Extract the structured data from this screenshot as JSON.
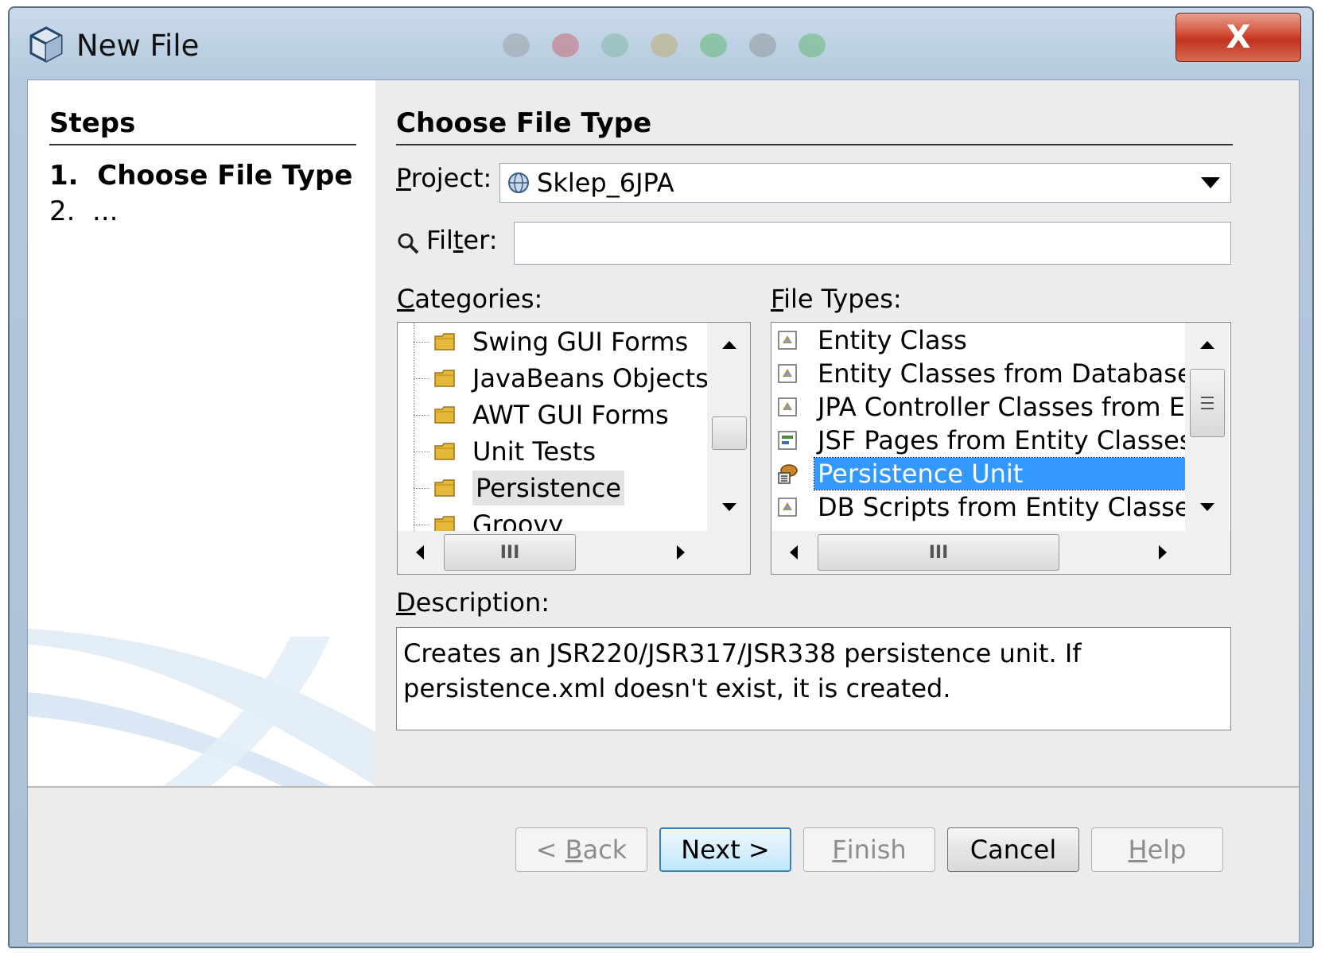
{
  "window": {
    "title": "New File",
    "close_label": "X"
  },
  "steps": {
    "heading": "Steps",
    "items": [
      "1.  Choose File Type",
      "2.  ..."
    ]
  },
  "main": {
    "heading": "Choose File Type",
    "project_label_mnemonic": "P",
    "project_label_rest": "roject:",
    "project_value": "Sklep_6JPA",
    "filter_label_pre": "Fil",
    "filter_label_mnemonic": "t",
    "filter_label_post": "er:",
    "filter_value": "",
    "categories_label_mnemonic": "C",
    "categories_label_rest": "ategories:",
    "categories": [
      {
        "label": "Swing GUI Forms",
        "selected": false
      },
      {
        "label": "JavaBeans Objects",
        "selected": false
      },
      {
        "label": "AWT GUI Forms",
        "selected": false
      },
      {
        "label": "Unit Tests",
        "selected": false
      },
      {
        "label": "Persistence",
        "selected": true
      },
      {
        "label": "Groovy",
        "selected": false
      }
    ],
    "file_types_label_mnemonic": "F",
    "file_types_label_rest": "ile Types:",
    "file_types": [
      {
        "label": "Entity Class",
        "icon": "entity-class-icon",
        "selected": false
      },
      {
        "label": "Entity Classes from Database",
        "icon": "entity-class-icon",
        "selected": false
      },
      {
        "label": "JPA Controller Classes from Ent",
        "icon": "entity-class-icon",
        "selected": false
      },
      {
        "label": "JSF Pages from Entity Classes",
        "icon": "jsf-page-icon",
        "selected": false
      },
      {
        "label": "Persistence Unit",
        "icon": "persistence-unit-icon",
        "selected": true
      },
      {
        "label": "DB Scripts from Entity Classes",
        "icon": "entity-class-icon",
        "selected": false
      }
    ],
    "description_label_mnemonic": "D",
    "description_label_rest": "escription:",
    "description_text": "Creates an JSR220/JSR317/JSR338 persistence unit. If persistence.xml doesn't exist, it is created.",
    "scroll_grip": "III"
  },
  "buttons": {
    "back_pre": "< ",
    "back_mnemonic": "B",
    "back_post": "ack",
    "next": "Next >",
    "finish_mnemonic": "F",
    "finish_post": "inish",
    "cancel": "Cancel",
    "help_mnemonic": "H",
    "help_post": "elp"
  },
  "colors": {
    "selection": "#3399ff",
    "default_button_border": "#3c7fb1",
    "close_button": "#c0331f"
  }
}
